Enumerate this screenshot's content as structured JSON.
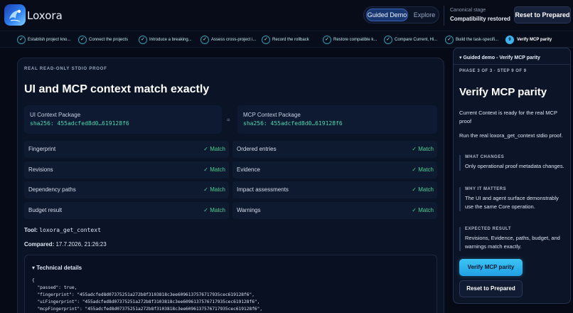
{
  "header": {
    "brand": "Loxora",
    "mode_guided": "Guided Demo",
    "mode_explore": "Explore",
    "stage_caption": "Canonical stage",
    "stage_value": "Compatibility restored",
    "reset_label": "Reset to Prepared"
  },
  "steps": [
    {
      "label": "Establish project kno..."
    },
    {
      "label": "Connect the projects"
    },
    {
      "label": "Introduce a breaking..."
    },
    {
      "label": "Assess cross-project i..."
    },
    {
      "label": "Record the rollback"
    },
    {
      "label": "Restore compatible k..."
    },
    {
      "label": "Compare Current, Hi..."
    },
    {
      "label": "Build the task-specifi..."
    },
    {
      "number": "9",
      "label": "Verify MCP parity"
    }
  ],
  "proof": {
    "eyebrow": "REAL READ-ONLY STDIO PROOF",
    "title": "UI and MCP context match exactly",
    "ui_package": {
      "label": "UI Context Package",
      "hash": "sha256: 455adcfed8d0…619128f6"
    },
    "equals": "=",
    "mcp_package": {
      "label": "MCP Context Package",
      "hash": "sha256: 455adcfed8d0…619128f6"
    },
    "match_text": "✓ Match",
    "checks": [
      "Fingerprint",
      "Ordered entries",
      "Revisions",
      "Evidence",
      "Dependency paths",
      "Impact assessments",
      "Budget result",
      "Warnings"
    ],
    "tool_label": "Tool:",
    "tool_value": "loxora_get_context",
    "compared_label": "Compared:",
    "compared_value": "17.7.2026, 21:26:23",
    "technical_title": "▾ Technical details",
    "technical_lines": [
      "{",
      "  \"passed\": true,",
      "  \"fingerprint\": \"455adcfed8d07375251a272b8f3103818c3ee6096137576717935cec619128f6\",",
      "  \"uiFingerprint\": \"455adcfed8d07375251a272b8f3103818c3ee6096137576717935cec619128f6\",",
      "  \"mcpFingerprint\": \"455adcfed8d07375251a272b8f3103818c3ee6096137576717935cec619128f6\","
    ]
  },
  "guide": {
    "header": "▾ Guided demo - Verify MCP parity",
    "phase": "PHASE 3 OF 3 · STEP 9 OF 9",
    "title": "Verify MCP parity",
    "para1": "Current Context is ready for the real MCP proof",
    "para2": "Run the real loxora_get_context stdio proof.",
    "sections": [
      {
        "caption": "WHAT CHANGES",
        "text": "Only operational proof metadata changes."
      },
      {
        "caption": "WHY IT MATTERS",
        "text": "The UI and agent surface demonstrably use the same Core operation."
      },
      {
        "caption": "EXPECTED RESULT",
        "text": "Revisions, Evidence, paths, budget, and warnings match exactly."
      }
    ],
    "verify_label": "Verify MCP parity",
    "reset_label": "Reset to Prepared"
  }
}
